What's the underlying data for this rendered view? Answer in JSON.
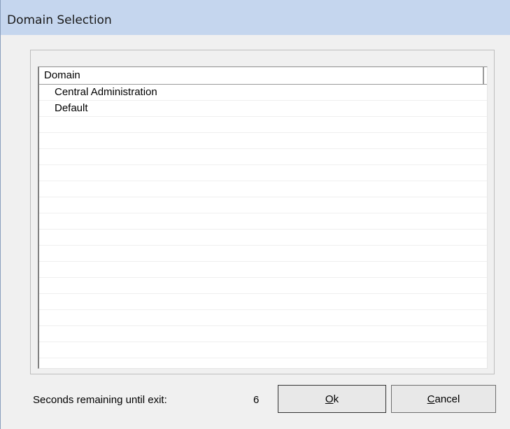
{
  "window": {
    "title": "Domain Selection"
  },
  "list": {
    "header": "Domain",
    "rows": [
      "Central Administration",
      "Default",
      "",
      "",
      "",
      "",
      "",
      "",
      "",
      "",
      "",
      "",
      "",
      "",
      "",
      "",
      "",
      ""
    ]
  },
  "status": {
    "label": "Seconds remaining until exit:",
    "seconds": "6"
  },
  "buttons": {
    "ok": {
      "accel": "O",
      "rest": "k"
    },
    "cancel": {
      "accel": "C",
      "rest": "ancel"
    }
  }
}
